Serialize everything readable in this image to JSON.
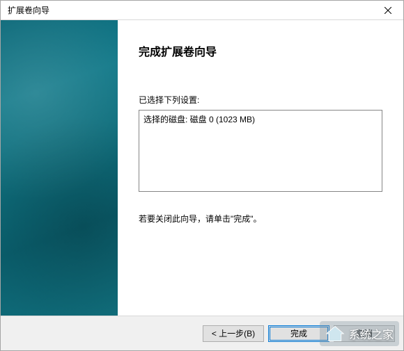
{
  "titlebar": {
    "title": "扩展卷向导"
  },
  "content": {
    "heading": "完成扩展卷向导",
    "settings_label": "已选择下列设置:",
    "settings_text": "选择的磁盘: 磁盘 0 (1023 MB)",
    "instruction": "若要关闭此向导，请单击\"完成\"。"
  },
  "footer": {
    "back_label": "< 上一步(B)",
    "finish_label": "完成",
    "cancel_label": "取消"
  },
  "watermark": {
    "text": "系统之家"
  }
}
